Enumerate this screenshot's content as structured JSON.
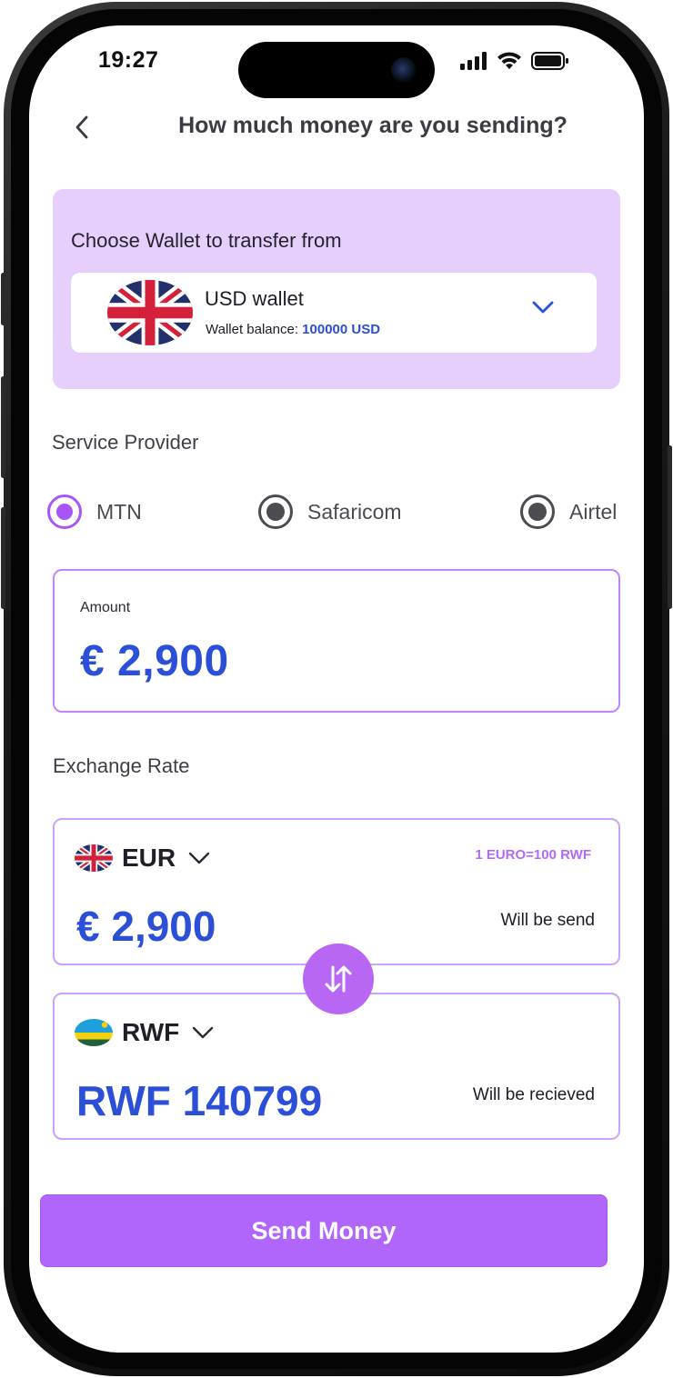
{
  "status_bar": {
    "time": "19:27"
  },
  "header": {
    "title": "How much money are you sending?"
  },
  "wallet": {
    "heading": "Choose Wallet to transfer from",
    "name": "USD wallet",
    "balance_label": "Wallet balance:",
    "balance_value": "100000 USD"
  },
  "provider": {
    "label": "Service Provider",
    "options": [
      "MTN",
      "Safaricom",
      "Airtel"
    ],
    "selected": "MTN"
  },
  "amount": {
    "label": "Amount",
    "value": "€ 2,900"
  },
  "exchange": {
    "label": "Exchange Rate",
    "from": {
      "currency": "EUR",
      "rate": "1 EURO=100 RWF",
      "amount": "€ 2,900",
      "note": "Will be send"
    },
    "to": {
      "currency": "RWF",
      "amount": "RWF 140799",
      "note": "Will be recieved"
    }
  },
  "actions": {
    "send_label": "Send Money"
  },
  "icons": {
    "back": "chevron-left-icon",
    "dropdown": "chevron-down-icon",
    "swap": "swap-vertical-icon",
    "signal": "cellular-signal-icon",
    "wifi": "wifi-icon",
    "battery": "battery-icon"
  },
  "colors": {
    "accent": "#a855f7",
    "accent_light": "#e7cffd",
    "amount_blue": "#2b4fd6",
    "button": "#b066fb"
  }
}
